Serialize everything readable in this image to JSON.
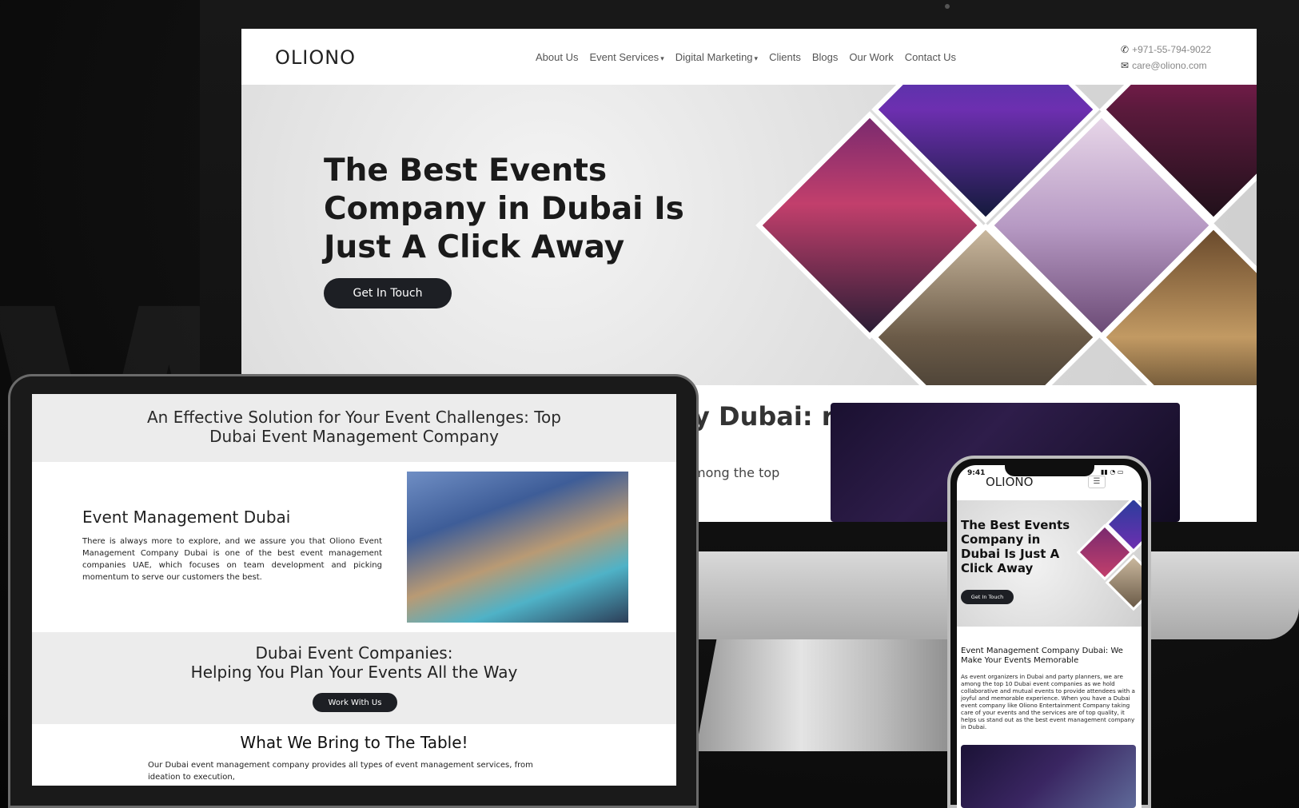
{
  "desktop": {
    "logo": "OLIONO",
    "nav": {
      "items": [
        {
          "label": "About Us",
          "dropdown": false
        },
        {
          "label": "Event Services",
          "dropdown": true
        },
        {
          "label": "Digital Marketing",
          "dropdown": true
        },
        {
          "label": "Clients",
          "dropdown": false
        },
        {
          "label": "Blogs",
          "dropdown": false
        },
        {
          "label": "Our Work",
          "dropdown": false
        },
        {
          "label": "Contact Us",
          "dropdown": false
        }
      ],
      "phone": "+971-55-794-9022",
      "email": "care@oliono.com"
    },
    "hero": {
      "title": "The Best Events Company in Dubai Is Just A Click Away",
      "button": "Get In Touch"
    },
    "lower": {
      "heading": "y Dubai: rable",
      "text": "mong the top"
    }
  },
  "tablet": {
    "section1_title": "An Effective Solution for Your Event Challenges: Top Dubai Event Management Company",
    "section2": {
      "heading": "Event Management Dubai",
      "text": "There is always more to explore, and we assure you that Oliono Event Management Company Dubai is one of the best event management companies UAE, which focuses on team development and picking momentum to serve our customers the best."
    },
    "section3": {
      "title_line1": "Dubai Event Companies:",
      "title_line2": "Helping You Plan Your Events All the Way",
      "button": "Work With Us"
    },
    "section4": {
      "title": "What We Bring to The Table!",
      "text": "Our Dubai event management company provides all types of event management services, from ideation to execution,"
    }
  },
  "phone": {
    "time": "9:41",
    "logo": "OLIONO",
    "menu_icon": "☰",
    "hero_title": "The Best Events Company in Dubai Is Just A Click Away",
    "hero_button": "Get In Touch",
    "heading": "Event Management Company Dubai: We Make Your Events Memorable",
    "text": "As event organizers in Dubai and party planners, we are among the top 10 Dubai event companies as we hold collaborative and mutual events to provide attendees with a joyful and memorable experience. When you have a Dubai event company like Oliono Entertainment Company taking care of your events and the services are of top quality, it helps us stand out as the best event management company in Dubai."
  },
  "icons": {
    "phone": "phone-icon",
    "email": "envelope-icon",
    "menu": "hamburger-icon",
    "dropdown": "caret-down-icon"
  },
  "colors": {
    "button_dark": "#1d1f24",
    "background": "#0b0b0b",
    "section_grey": "#ececec"
  }
}
